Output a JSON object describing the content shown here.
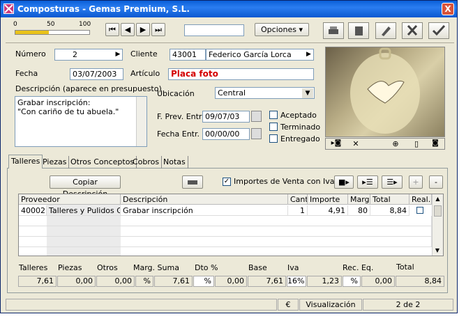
{
  "window": {
    "title": "Composturas - Gemas Premium, S.L.",
    "close": "X"
  },
  "zoom": {
    "ticks": [
      "0",
      "50",
      "100"
    ],
    "level_percent": 45
  },
  "toolbar": {
    "opciones": "Opciones"
  },
  "form": {
    "numero_label": "Número",
    "numero": "2",
    "cliente_label": "Cliente",
    "cliente_code": "43001",
    "cliente_name": "Federico García Lorca",
    "fecha_label": "Fecha",
    "fecha": "03/07/2003",
    "articulo_label": "Artículo",
    "articulo": "Placa foto",
    "descripcion_label": "Descripción (aparece en presupuesto)",
    "descripcion_line1": "Grabar inscripción:",
    "descripcion_line2": "\"Con cariño de tu abuela.\"",
    "ubicacion_label": "Ubicación",
    "ubicacion": "Central",
    "fprev_label": "F. Prev. Entr",
    "fprev": "09/07/03",
    "fentr_label": "Fecha Entr.",
    "fentr": "00/00/00",
    "aceptado": "Aceptado",
    "terminado": "Terminado",
    "entregado": "Entregado"
  },
  "tabs": [
    "Talleres",
    "Piezas",
    "Otros Conceptos",
    "Cobros",
    "Notas"
  ],
  "talleres": {
    "copiar": "Copiar Descripción",
    "importes_iva": "Importes de Venta con Iva",
    "plus": "+",
    "minus": "-"
  },
  "grid": {
    "headers": [
      "Proveedor",
      "Descripción",
      "Cant",
      "Importe",
      "Marg",
      "Total",
      "Real."
    ],
    "rows": [
      [
        "40002",
        "Talleres y Pulidos Gar",
        "Grabar inscripción",
        "1",
        "4,91",
        "80",
        "8,84"
      ]
    ]
  },
  "totals": {
    "labels": [
      "Talleres",
      "Piezas",
      "Otros",
      "Marg. Suma",
      "Dto %",
      "Base",
      "Iva",
      "Rec. Eq.",
      "Total"
    ],
    "talleres": "7,61",
    "piezas": "0,00",
    "otros": "0,00",
    "pct1": "%",
    "marg": "7,61",
    "pct2": "%",
    "dto": "0,00",
    "base": "7,61",
    "iva": "16%",
    "iva_val": "1,23",
    "pct3": "%",
    "receq": "0,00",
    "total": "8,84"
  },
  "status": {
    "currency": "€",
    "mode": "Visualización",
    "page": "2 de 2"
  }
}
